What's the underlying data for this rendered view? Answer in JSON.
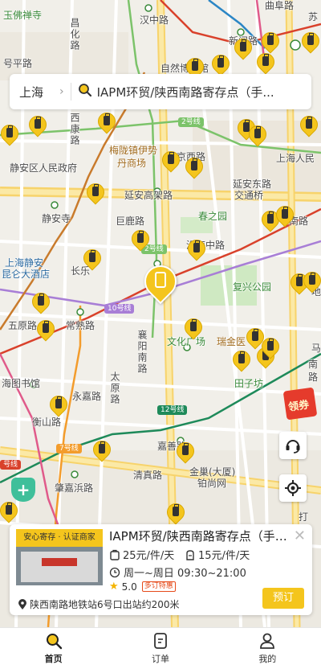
{
  "search": {
    "city": "上海",
    "query": "IAPM环贸/陕西南路寄存点（手..."
  },
  "map": {
    "labels": [
      {
        "t": "玉佛禅寺",
        "c": "green"
      },
      {
        "t": "汉中路",
        "c": ""
      },
      {
        "t": "新闸路",
        "c": ""
      },
      {
        "t": "曲阜路",
        "c": ""
      },
      {
        "t": "昌化路",
        "c": ""
      },
      {
        "t": "号平路",
        "c": ""
      },
      {
        "t": "自然博物馆",
        "c": ""
      },
      {
        "t": "西康路",
        "c": ""
      },
      {
        "t": "2号线",
        "c": "green"
      },
      {
        "t": "静安区人民政府",
        "c": ""
      },
      {
        "t": "梅陇镇伊势",
        "c": "brown"
      },
      {
        "t": "丹商场",
        "c": "brown"
      },
      {
        "t": "京西路",
        "c": ""
      },
      {
        "t": "上海人民",
        "c": ""
      },
      {
        "t": "延安东路",
        "c": ""
      },
      {
        "t": "交通桥",
        "c": ""
      },
      {
        "t": "延安高架路",
        "c": ""
      },
      {
        "t": "静安寺",
        "c": ""
      },
      {
        "t": "巨鹿路",
        "c": ""
      },
      {
        "t": "春之园",
        "c": "green"
      },
      {
        "t": "南路",
        "c": ""
      },
      {
        "t": "2号线",
        "c": "green"
      },
      {
        "t": "淮海中路",
        "c": ""
      },
      {
        "t": "上海静安",
        "c": "blue"
      },
      {
        "t": "昆仑大酒店",
        "c": "blue"
      },
      {
        "t": "长乐",
        "c": ""
      },
      {
        "t": "复兴公园",
        "c": "green"
      },
      {
        "t": "10号线",
        "c": ""
      },
      {
        "t": "五原路",
        "c": ""
      },
      {
        "t": "常熟路",
        "c": ""
      },
      {
        "t": "襄阳南路",
        "c": ""
      },
      {
        "t": "文化广场",
        "c": "green"
      },
      {
        "t": "瑞金医",
        "c": "brown"
      },
      {
        "t": "海图书馆",
        "c": ""
      },
      {
        "t": "永嘉路",
        "c": ""
      },
      {
        "t": "太原路",
        "c": ""
      },
      {
        "t": "田子坊",
        "c": "green"
      },
      {
        "t": "衡山路",
        "c": ""
      },
      {
        "t": "12号线",
        "c": "green"
      },
      {
        "t": "7号线",
        "c": ""
      },
      {
        "t": "嘉善路",
        "c": ""
      },
      {
        "t": "肇嘉浜路",
        "c": ""
      },
      {
        "t": "清真路",
        "c": ""
      },
      {
        "t": "金巢(大厦)",
        "c": ""
      },
      {
        "t": "铂尚网",
        "c": ""
      },
      {
        "t": "号线",
        "c": ""
      },
      {
        "t": "苏",
        "c": ""
      },
      {
        "t": "马",
        "c": ""
      },
      {
        "t": "南",
        "c": ""
      },
      {
        "t": "路",
        "c": ""
      },
      {
        "t": "打",
        "c": ""
      },
      {
        "t": "地",
        "c": ""
      }
    ]
  },
  "controls": {
    "coupon_label": "领券"
  },
  "card": {
    "badge": "安心寄存 · 认证商家",
    "title": "IAPM环贸/陕西南路寄存点（手机...",
    "price_small": "25元/件/天",
    "price_large": "15元/件/天",
    "hours": "周一~周日 09:30~21:00",
    "rating": "5.0",
    "discount": "多订特惠",
    "address": "陕西南路地铁站6号口出站约200米",
    "book_label": "预订"
  },
  "tabs": [
    {
      "label": "首页",
      "icon": "search-icon",
      "active": true
    },
    {
      "label": "订单",
      "icon": "orders-icon",
      "active": false
    },
    {
      "label": "我的",
      "icon": "profile-icon",
      "active": false
    }
  ],
  "colors": {
    "accent": "#f4c51d",
    "pin": "#f4c51d",
    "coupon": "#e53b2c",
    "line2": "#7cc36a",
    "line10": "#a87ed6",
    "line7": "#f39c2c",
    "line12": "#1e8a5a"
  }
}
